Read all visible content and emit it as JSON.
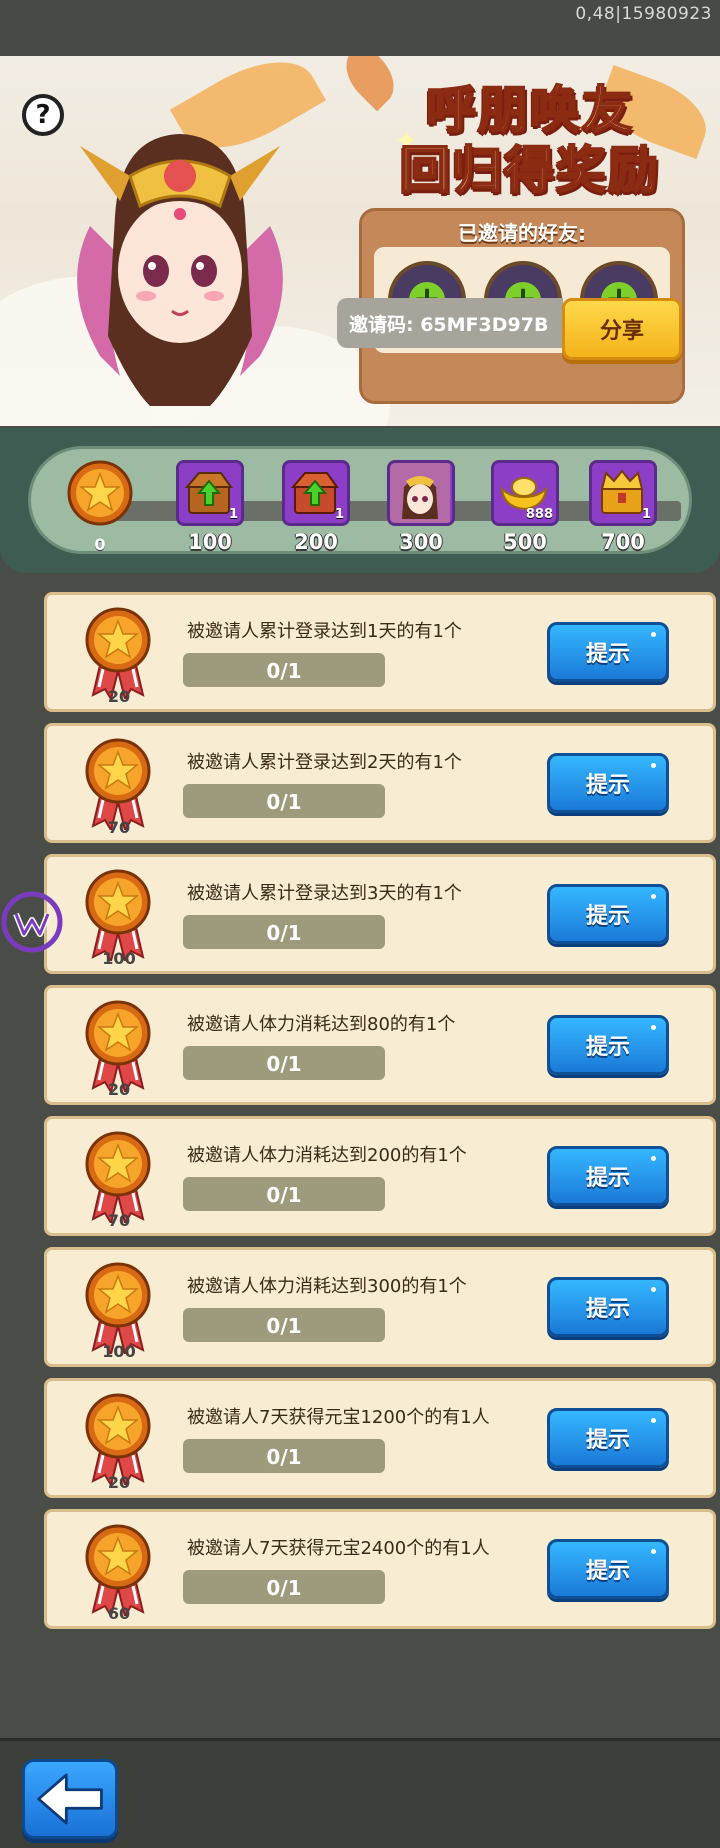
{
  "status": {
    "text": "0,48|15980923"
  },
  "banner": {
    "title_line1": "呼朋唤友",
    "title_line2": "回归得奖励",
    "friends_label": "已邀请的好友:",
    "invite_code": "邀请码: 65MF3D97B",
    "share_label": "分享",
    "help_label": "?"
  },
  "progress": {
    "total": "0",
    "milestones": [
      {
        "label": "100",
        "qty": "1",
        "icon": "upgrade-chest-icon"
      },
      {
        "label": "200",
        "qty": "1",
        "icon": "upgrade-chest-icon"
      },
      {
        "label": "300",
        "qty": "",
        "icon": "hero-portrait-icon"
      },
      {
        "label": "500",
        "qty": "888",
        "icon": "gold-ingot-icon"
      },
      {
        "label": "700",
        "qty": "1",
        "icon": "golden-chest-icon"
      }
    ]
  },
  "tasks": [
    {
      "points": "20",
      "desc": "被邀请人累计登录达到1天的有1个",
      "progress": "0/1",
      "button": "提示"
    },
    {
      "points": "70",
      "desc": "被邀请人累计登录达到2天的有1个",
      "progress": "0/1",
      "button": "提示"
    },
    {
      "points": "100",
      "desc": "被邀请人累计登录达到3天的有1个",
      "progress": "0/1",
      "button": "提示"
    },
    {
      "points": "20",
      "desc": "被邀请人体力消耗达到80的有1个",
      "progress": "0/1",
      "button": "提示"
    },
    {
      "points": "70",
      "desc": "被邀请人体力消耗达到200的有1个",
      "progress": "0/1",
      "button": "提示"
    },
    {
      "points": "100",
      "desc": "被邀请人体力消耗达到300的有1个",
      "progress": "0/1",
      "button": "提示"
    },
    {
      "points": "20",
      "desc": "被邀请人7天获得元宝1200个的有1人",
      "progress": "0/1",
      "button": "提示"
    },
    {
      "points": "60",
      "desc": "被邀请人7天获得元宝2400个的有1人",
      "progress": "0/1",
      "button": "提示"
    }
  ],
  "colors": {
    "accent_blue": "#1a7ad8",
    "share_yellow": "#f4b31a",
    "reward_purple": "#8c3fc6",
    "plus_green": "#7fcf2a"
  }
}
